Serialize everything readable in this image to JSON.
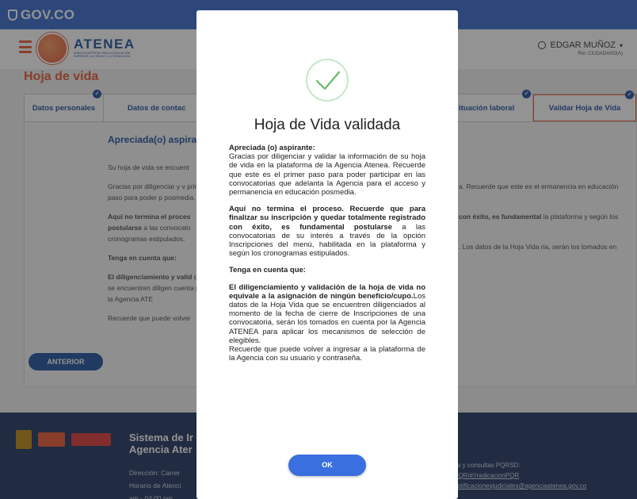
{
  "gov": {
    "logo": "GOV.CO"
  },
  "header": {
    "brand": "ATENEA",
    "brand_sub": "AGENCIA DISTRITAL PARA LA EDUCACIÓN SUPERIOR, LA CIENCIA Y LA TECNOLOGÍA",
    "user_name": "EDGAR MUÑOZ",
    "user_role": "Rol: CIUDADANO(A)"
  },
  "page": {
    "title": "Hoja de vida"
  },
  "tabs": [
    {
      "label": "Datos personales",
      "checked": true
    },
    {
      "label": "Datos de contac",
      "checked": false
    },
    {
      "label": "ituación laboral",
      "checked": true
    },
    {
      "label": "Validar Hoja de Vida",
      "checked": true
    }
  ],
  "content": {
    "title": "Apreciada(o) aspirar",
    "p1": "Su hoja de vida se encuent",
    "p2": "Gracias por diligenciar y v primer paso para poder p posmedia.",
    "p3_bold": "Aquí no termina el proces postularse",
    "p3_rest": " a las convocato cronogramas estipulados.",
    "p4": "Tenga en cuenta que:",
    "p5_bold": "El diligenciamiento y valid",
    "p5_rest": " que se encuentren diligen cuenta por la Agencia ATE",
    "p6": "Recuerde que puede volver",
    "right1": "a. Recuerde que este es el ermanencia en educación",
    "right2_bold": "con éxito, es fundamental",
    "right2_rest": " la plataforma y según los",
    "right3": ". Los datos de la Hoja Vida ria, serán los tomados en",
    "prev_button": "ANTERIOR"
  },
  "footer": {
    "system_title_1": "Sistema de Ir",
    "system_title_2": "Agencia Ater",
    "addr_1": "Dirección: Carrer",
    "addr_2": "Horario de Atenci",
    "addr_3": "am - 04:00 pm.",
    "pqr_1": "os y consultas PQRSD:",
    "pqr_2": "PQR/#!/radicacionPQR",
    "pqr_3": "notificacionesjudiciales@agenciaatenea.gov.co"
  },
  "modal": {
    "title": "Hoja de Vida validada",
    "greeting": "Apreciada (o) aspirante:",
    "para1": "Gracias por diligenciar y validar la información de su hoja de vida en la plataforma de la Agencia Atenea. Recuerde que este es el primer paso para poder participar en las convocatorias que adelanta la Agencia para el acceso y permanencia en educación posmedia.",
    "para2_bold": "Aquí no termina el proceso. Recuerde que para finalizar su inscripción y quedar totalmente registrado con éxito, es fundamental postularse",
    "para2_rest": " a las convocatorias de su interés a través de la opción Inscripciones del menú, habilitada en la plataforma y según los cronogramas estipulados.",
    "note_heading": "Tenga en cuenta que:",
    "para3_bold": "El diligenciamiento y validación de la hoja de vida no equivale a la asignación de ningún beneficio/cupo.",
    "para3_rest": "Los datos de la Hoja Vida que se encuentren diligenciados al momento de la fecha de cierre de Inscripciones de una convocatoria, serán los tomados en cuenta por la Agencia ATENEA para aplicar los mecanismos de selección de elegibles.",
    "para4": "Recuerde que puede volver a ingresar a la plataforma de la Agencia con su usuario y contraseña.",
    "ok_button": "OK"
  },
  "colors": {
    "accent": "#e8542f",
    "brand_blue": "#1b4c9c",
    "gov_blue": "#3366cc",
    "ok_blue": "#3a6fe0",
    "check_green": "#66bb6a"
  },
  "icons": [
    "gov-shield-icon",
    "hamburger-menu-icon",
    "user-icon",
    "chevron-down-icon",
    "check-badge-icon",
    "success-check-icon"
  ]
}
